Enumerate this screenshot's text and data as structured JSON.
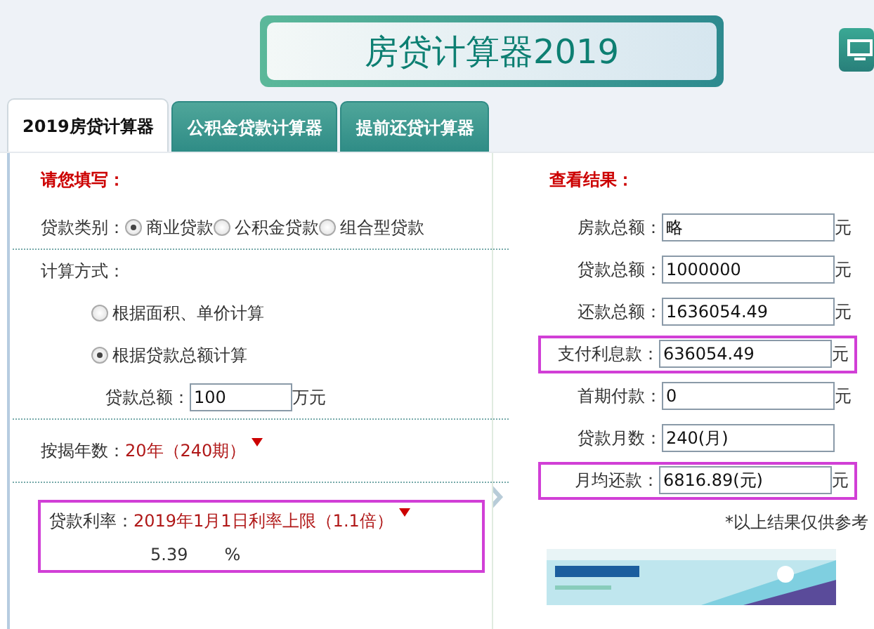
{
  "title": "房贷计算器2019",
  "tabs": [
    {
      "label": "2019房贷计算器",
      "selected": true
    },
    {
      "label": "公积金贷款计算器",
      "selected": false
    },
    {
      "label": "提前还贷计算器",
      "selected": false
    }
  ],
  "form": {
    "heading": "请您填写：",
    "loan_type": {
      "label": "贷款类别：",
      "options": [
        {
          "label": "商业贷款",
          "selected": true
        },
        {
          "label": "公积金贷款",
          "selected": false
        },
        {
          "label": "组合型贷款",
          "selected": false
        }
      ]
    },
    "method": {
      "label": "计算方式：",
      "options": [
        {
          "label": "根据面积、单价计算",
          "selected": false
        },
        {
          "label": "根据贷款总额计算",
          "selected": true
        }
      ]
    },
    "amount": {
      "label": "贷款总额：",
      "value": "100",
      "unit": "万元"
    },
    "years": {
      "label": "按揭年数：",
      "value": "20年（240期）"
    },
    "rate": {
      "label": "贷款利率：",
      "value": "2019年1月1日利率上限（1.1倍）",
      "rate_value": "5.39",
      "unit": "%",
      "highlighted": true
    }
  },
  "results": {
    "heading": "查看结果：",
    "fields": [
      {
        "label": "房款总额：",
        "value": "略",
        "unit": "元",
        "highlighted": false
      },
      {
        "label": "贷款总额：",
        "value": "1000000",
        "unit": "元",
        "highlighted": false
      },
      {
        "label": "还款总额：",
        "value": "1636054.49",
        "unit": "元",
        "highlighted": false
      },
      {
        "label": "支付利息款：",
        "value": "636054.49",
        "unit": "元",
        "highlighted": true
      },
      {
        "label": "首期付款：",
        "value": "0",
        "unit": "元",
        "highlighted": false
      },
      {
        "label": "贷款月数：",
        "value": "240(月)",
        "highlighted": false
      },
      {
        "label": "月均还款：",
        "value": "6816.89(元)",
        "unit": "元",
        "highlighted": true
      }
    ],
    "note": "*以上结果仅供参考"
  }
}
